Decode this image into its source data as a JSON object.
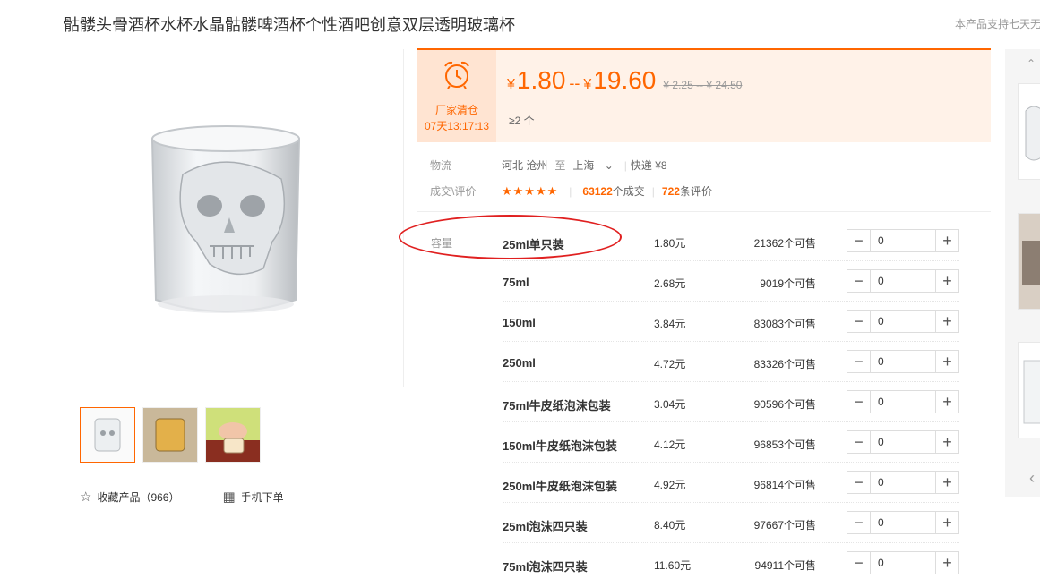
{
  "product": {
    "title": "骷髅头骨酒杯水杯水晶骷髅啤酒杯个性酒吧创意双层透明玻璃杯",
    "notice": "本产品支持七天无"
  },
  "gallery": {
    "actions": [
      {
        "icon": "star-outline-icon",
        "label": "收藏产品（966）"
      },
      {
        "icon": "qr-code-icon",
        "label": "手机下单"
      }
    ]
  },
  "price": {
    "promo_label": "厂家清仓",
    "countdown": "07天13:17:13",
    "currency": "¥",
    "low": "1.80",
    "separator": "--",
    "high": "19.60",
    "original": "¥ 2.25 -- ¥ 24.50",
    "moq": "≥2 个"
  },
  "logistics": {
    "label": "物流",
    "from": "河北 沧州",
    "to_word": "至",
    "to": "上海",
    "express": "快递 ¥8"
  },
  "rating": {
    "label": "成交\\评价",
    "stars": "★★★★★",
    "deals_count": "63122",
    "deals_label": "个成交",
    "reviews_count": "722",
    "reviews_label": "条评价"
  },
  "specs": {
    "label": "容量",
    "rows": [
      {
        "name": "25ml单只装",
        "price": "1.80元",
        "stock": "21362个可售",
        "qty": "0"
      },
      {
        "name": "75ml",
        "price": "2.68元",
        "stock": "9019个可售",
        "qty": "0"
      },
      {
        "name": "150ml",
        "price": "3.84元",
        "stock": "83083个可售",
        "qty": "0"
      },
      {
        "name": "250ml",
        "price": "4.72元",
        "stock": "83326个可售",
        "qty": "0"
      },
      {
        "name": "75ml牛皮纸泡沫包装",
        "price": "3.04元",
        "stock": "90596个可售",
        "qty": "0"
      },
      {
        "name": "150ml牛皮纸泡沫包装",
        "price": "4.12元",
        "stock": "96853个可售",
        "qty": "0"
      },
      {
        "name": "250ml牛皮纸泡沫包装",
        "price": "4.92元",
        "stock": "96814个可售",
        "qty": "0"
      },
      {
        "name": "25ml泡沫四只装",
        "price": "8.40元",
        "stock": "97667个可售",
        "qty": "0"
      },
      {
        "name": "75ml泡沫四只装",
        "price": "11.60元",
        "stock": "94911个可售",
        "qty": "0"
      }
    ]
  },
  "stepper": {
    "minus": "−",
    "plus": "+"
  },
  "colors": {
    "accent": "#ff6600",
    "highlight_ring": "#e02020",
    "price_bg": "#fff2e8"
  }
}
